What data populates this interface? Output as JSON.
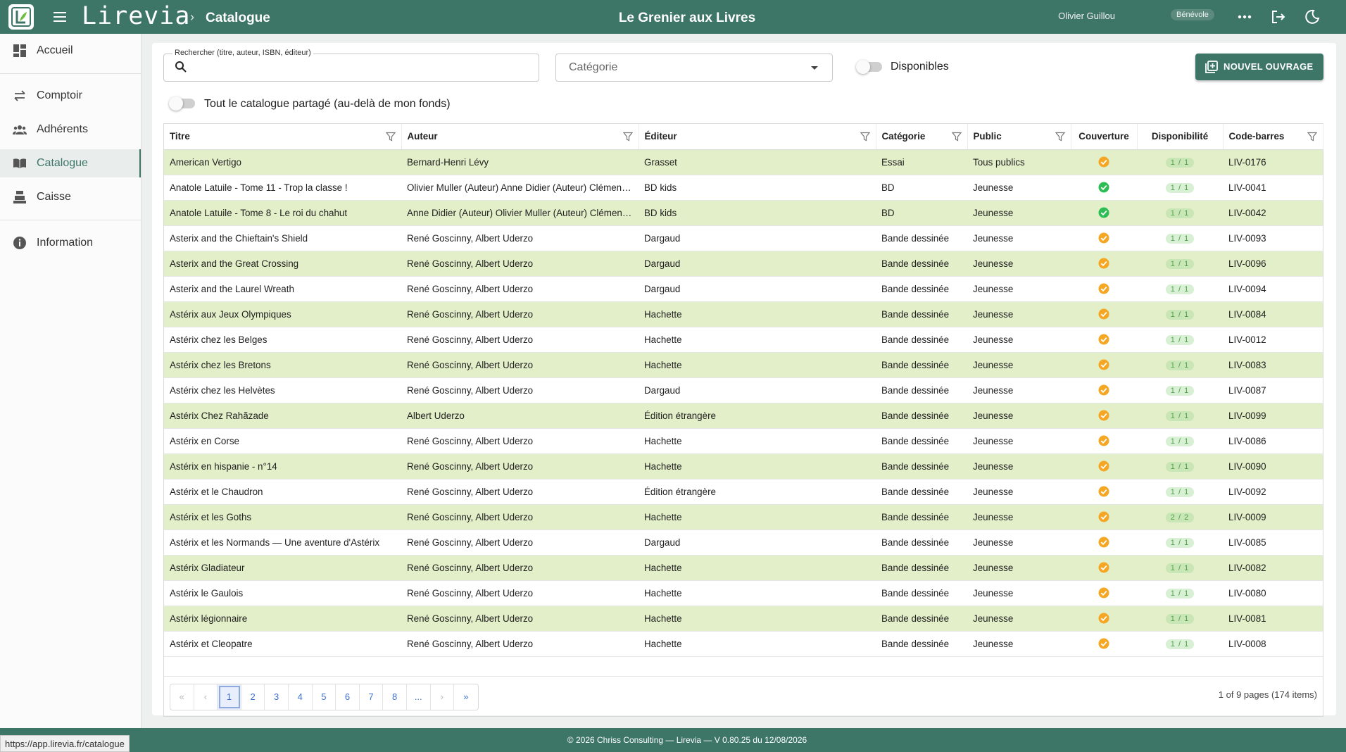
{
  "app": {
    "name": "Lirevia",
    "breadcrumb": "Catalogue",
    "shop_name": "Le Grenier aux Livres"
  },
  "user": {
    "name": "Olivier Guillou",
    "role": "Bénévole"
  },
  "sidebar": {
    "items": [
      {
        "label": "Accueil",
        "icon": "dashboard-icon"
      },
      {
        "label": "Comptoir",
        "icon": "swap-arrows-icon"
      },
      {
        "label": "Adhérents",
        "icon": "people-icon"
      },
      {
        "label": "Catalogue",
        "icon": "book-open-icon",
        "active": true
      },
      {
        "label": "Caisse",
        "icon": "cash-register-icon"
      },
      {
        "label": "Information",
        "icon": "info-icon"
      }
    ]
  },
  "filters": {
    "search_label": "Rechercher (titre, auteur, ISBN, éditeur)",
    "search_value": "",
    "category_placeholder": "Catégorie",
    "available_label": "Disponibles",
    "available_on": false,
    "shared_label": "Tout le catalogue partagé (au-delà de mon fonds)",
    "shared_on": false,
    "new_button": "NOUVEL OUVRAGE"
  },
  "table": {
    "columns": [
      "Titre",
      "Auteur",
      "Éditeur",
      "Catégorie",
      "Public",
      "Couverture",
      "Disponibilité",
      "Code-barres"
    ],
    "rows": [
      {
        "titre": "American Vertigo",
        "auteur": "Bernard-Henri Lévy",
        "editeur": "Grasset",
        "categorie": "Essai",
        "public": "Tous publics",
        "couverture": "partial",
        "dispo": "1 / 1",
        "code": "LIV-0176"
      },
      {
        "titre": "Anatole Latuile - Tome 11 - Trop la classe !",
        "auteur": "Olivier Muller (Auteur) Anne Didier (Auteur) Clément Devaux (Illustrations)",
        "editeur": "BD kids",
        "categorie": "BD",
        "public": "Jeunesse",
        "couverture": "ok",
        "dispo": "1 / 1",
        "code": "LIV-0041"
      },
      {
        "titre": "Anatole Latuile - Tome 8 - Le roi du chahut",
        "auteur": "Anne Didier (Auteur) Olivier Muller (Auteur) Clément Devaux (Illustrations)",
        "editeur": "BD kids",
        "categorie": "BD",
        "public": "Jeunesse",
        "couverture": "ok",
        "dispo": "1 / 1",
        "code": "LIV-0042"
      },
      {
        "titre": "Asterix and the Chieftain's Shield",
        "auteur": "René Goscinny, Albert Uderzo",
        "editeur": "Dargaud",
        "categorie": "Bande dessinée",
        "public": "Jeunesse",
        "couverture": "partial",
        "dispo": "1 / 1",
        "code": "LIV-0093"
      },
      {
        "titre": "Asterix and the Great Crossing",
        "auteur": "René Goscinny, Albert Uderzo",
        "editeur": "Dargaud",
        "categorie": "Bande dessinée",
        "public": "Jeunesse",
        "couverture": "partial",
        "dispo": "1 / 1",
        "code": "LIV-0096"
      },
      {
        "titre": "Asterix and the Laurel Wreath",
        "auteur": "René Goscinny, Albert Uderzo",
        "editeur": "Dargaud",
        "categorie": "Bande dessinée",
        "public": "Jeunesse",
        "couverture": "partial",
        "dispo": "1 / 1",
        "code": "LIV-0094"
      },
      {
        "titre": "Astérix aux Jeux Olympiques",
        "auteur": "René Goscinny, Albert Uderzo",
        "editeur": "Hachette",
        "categorie": "Bande dessinée",
        "public": "Jeunesse",
        "couverture": "partial",
        "dispo": "1 / 1",
        "code": "LIV-0084"
      },
      {
        "titre": "Astérix chez les Belges",
        "auteur": "René Goscinny, Albert Uderzo",
        "editeur": "Hachette",
        "categorie": "Bande dessinée",
        "public": "Jeunesse",
        "couverture": "partial",
        "dispo": "1 / 1",
        "code": "LIV-0012"
      },
      {
        "titre": "Astérix chez les Bretons",
        "auteur": "René Goscinny, Albert Uderzo",
        "editeur": "Hachette",
        "categorie": "Bande dessinée",
        "public": "Jeunesse",
        "couverture": "partial",
        "dispo": "1 / 1",
        "code": "LIV-0083"
      },
      {
        "titre": "Astérix chez les Helvètes",
        "auteur": "René Goscinny, Albert Uderzo",
        "editeur": "Dargaud",
        "categorie": "Bande dessinée",
        "public": "Jeunesse",
        "couverture": "partial",
        "dispo": "1 / 1",
        "code": "LIV-0087"
      },
      {
        "titre": "Astérix Chez Rahãzade",
        "auteur": "Albert Uderzo",
        "editeur": "Édition étrangère",
        "categorie": "Bande dessinée",
        "public": "Jeunesse",
        "couverture": "partial",
        "dispo": "1 / 1",
        "code": "LIV-0099"
      },
      {
        "titre": "Astérix en Corse",
        "auteur": "René Goscinny, Albert Uderzo",
        "editeur": "Hachette",
        "categorie": "Bande dessinée",
        "public": "Jeunesse",
        "couverture": "partial",
        "dispo": "1 / 1",
        "code": "LIV-0086"
      },
      {
        "titre": "Astérix en hispanie - n°14",
        "auteur": "René Goscinny, Albert Uderzo",
        "editeur": "Hachette",
        "categorie": "Bande dessinée",
        "public": "Jeunesse",
        "couverture": "partial",
        "dispo": "1 / 1",
        "code": "LIV-0090"
      },
      {
        "titre": "Astérix et le Chaudron",
        "auteur": "René Goscinny, Albert Uderzo",
        "editeur": "Édition étrangère",
        "categorie": "Bande dessinée",
        "public": "Jeunesse",
        "couverture": "partial",
        "dispo": "1 / 1",
        "code": "LIV-0092"
      },
      {
        "titre": "Astérix et les Goths",
        "auteur": "René Goscinny, Albert Uderzo",
        "editeur": "Hachette",
        "categorie": "Bande dessinée",
        "public": "Jeunesse",
        "couverture": "partial",
        "dispo": "2 / 2",
        "code": "LIV-0009"
      },
      {
        "titre": "Astérix et les Normands — Une aventure d'Astérix",
        "auteur": "René Goscinny, Albert Uderzo",
        "editeur": "Dargaud",
        "categorie": "Bande dessinée",
        "public": "Jeunesse",
        "couverture": "partial",
        "dispo": "1 / 1",
        "code": "LIV-0085"
      },
      {
        "titre": "Astérix Gladiateur",
        "auteur": "René Goscinny, Albert Uderzo",
        "editeur": "Hachette",
        "categorie": "Bande dessinée",
        "public": "Jeunesse",
        "couverture": "partial",
        "dispo": "1 / 1",
        "code": "LIV-0082"
      },
      {
        "titre": "Astérix le Gaulois",
        "auteur": "René Goscinny, Albert Uderzo",
        "editeur": "Hachette",
        "categorie": "Bande dessinée",
        "public": "Jeunesse",
        "couverture": "partial",
        "dispo": "1 / 1",
        "code": "LIV-0080"
      },
      {
        "titre": "Astérix légionnaire",
        "auteur": "René Goscinny, Albert Uderzo",
        "editeur": "Hachette",
        "categorie": "Bande dessinée",
        "public": "Jeunesse",
        "couverture": "partial",
        "dispo": "1 / 1",
        "code": "LIV-0081"
      },
      {
        "titre": "Astérix et Cleopatre",
        "auteur": "René Goscinny, Albert Uderzo",
        "editeur": "Hachette",
        "categorie": "Bande dessinée",
        "public": "Jeunesse",
        "couverture": "partial",
        "dispo": "1 / 1",
        "code": "LIV-0008"
      }
    ]
  },
  "pager": {
    "first": "«",
    "prev": "‹",
    "pages": [
      "1",
      "2",
      "3",
      "4",
      "5",
      "6",
      "7",
      "8",
      "..."
    ],
    "current": "1",
    "next": "›",
    "last": "»",
    "info": "1 of 9 pages (174 items)"
  },
  "footer": {
    "text": "© 2026 Chriss Consulting — Lirevia — V 0.80.25 du 12/08/2026"
  },
  "status_url": "https://app.lirevia.fr/catalogue",
  "colors": {
    "brand": "#3d7566",
    "row_alt": "#e2efc8",
    "cover_ok": "#2ebd55",
    "cover_partial": "#f5a623",
    "dispo_text": "#4fa04a"
  }
}
